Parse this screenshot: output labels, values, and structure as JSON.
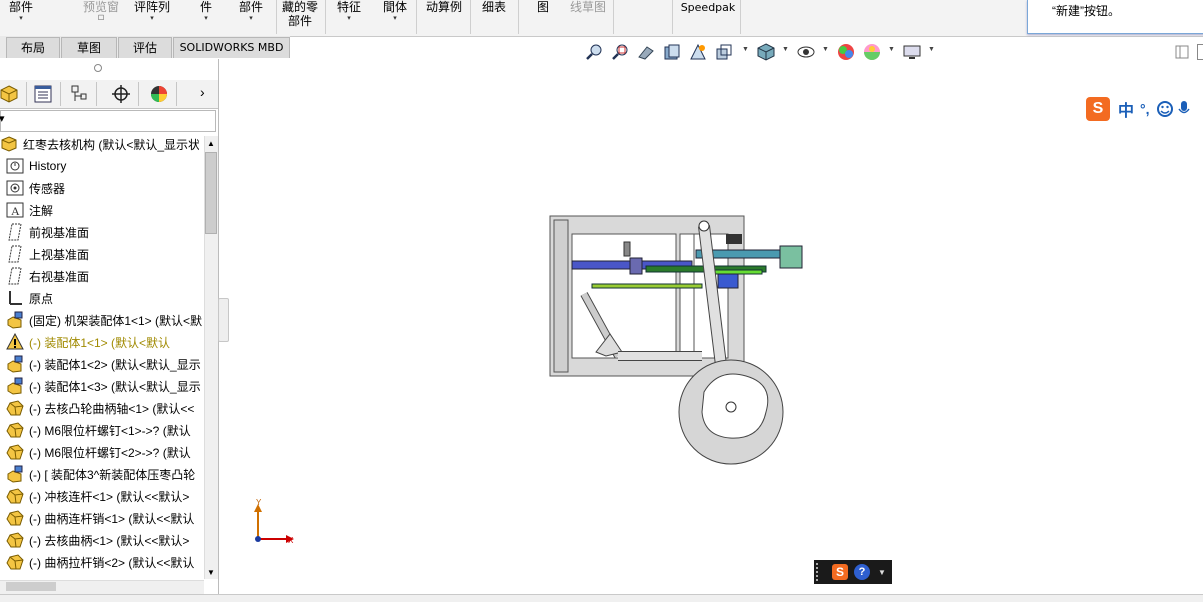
{
  "ribbon": {
    "items": [
      {
        "label": "部件",
        "arrow": "▾"
      },
      {
        "label": "预览窗",
        "arrow": "☐",
        "dim": true
      },
      {
        "label": "评阵列",
        "arrow": "▾"
      },
      {
        "label": "件",
        "arrow": "▾"
      },
      {
        "label": "部件",
        "arrow": "▾"
      },
      {
        "label": "藏的零部件",
        "arrow": ""
      },
      {
        "label": "特征",
        "arrow": "▾"
      },
      {
        "label": "間体",
        "arrow": "▾"
      },
      {
        "label": "动算例",
        "arrow": ""
      },
      {
        "label": "细表",
        "arrow": ""
      },
      {
        "label": "图",
        "arrow": ""
      },
      {
        "label": "线草图",
        "arrow": "",
        "dim": true
      },
      {
        "label": "Speedpak",
        "arrow": ""
      }
    ],
    "notification": "“新建”按钮。"
  },
  "tabs": [
    "布局",
    "草图",
    "评估",
    "SOLIDWORKS MBD"
  ],
  "panel": {
    "filter_icon": "filter-icon",
    "tree": [
      {
        "label": "红枣去核机构  (默认<默认_显示状态-",
        "icon": "assembly-icon"
      },
      {
        "label": "History",
        "icon": "history-icon"
      },
      {
        "label": "传感器",
        "icon": "sensor-icon"
      },
      {
        "label": "注解",
        "icon": "annotation-icon"
      },
      {
        "label": "前视基准面",
        "icon": "plane-icon"
      },
      {
        "label": "上视基准面",
        "icon": "plane-icon"
      },
      {
        "label": "右视基准面",
        "icon": "plane-icon"
      },
      {
        "label": "原点",
        "icon": "origin-icon"
      },
      {
        "label": "(固定) 机架装配体1<1> (默认<默",
        "icon": "subassembly-icon"
      },
      {
        "label": "(-) 装配体1<1> (默认<默认",
        "icon": "warning-icon",
        "warn": true
      },
      {
        "label": "(-) 装配体1<2> (默认<默认_显示",
        "icon": "subassembly-icon"
      },
      {
        "label": "(-) 装配体1<3> (默认<默认_显示",
        "icon": "subassembly-icon"
      },
      {
        "label": "(-) 去核凸轮曲柄轴<1> (默认<<",
        "icon": "part-icon"
      },
      {
        "label": "(-) M6限位杆螺钉<1>->? (默认",
        "icon": "part-icon"
      },
      {
        "label": "(-) M6限位杆螺钉<2>->? (默认",
        "icon": "part-icon"
      },
      {
        "label": "(-) [ 装配体3^新装配体压枣凸轮",
        "icon": "subassembly-icon"
      },
      {
        "label": "(-) 冲核连杆<1> (默认<<默认>",
        "icon": "part-icon"
      },
      {
        "label": "(-) 曲柄连杆销<1> (默认<<默认",
        "icon": "part-icon"
      },
      {
        "label": "(-) 去核曲柄<1> (默认<<默认>",
        "icon": "part-icon"
      },
      {
        "label": "(-) 曲柄拉杆销<2> (默认<<默认",
        "icon": "part-icon"
      }
    ]
  },
  "triad": {
    "x": "X",
    "y": "Y"
  },
  "ime": {
    "logo": "S",
    "lang": "中",
    "punct": "°,"
  },
  "ime2": {
    "logo": "S",
    "help": "?"
  },
  "colors": {
    "accent": "#2a6ebb",
    "frame": "#d9d9d9",
    "blue_bar": "#4a56c8",
    "green_bar": "#4fa44f"
  }
}
